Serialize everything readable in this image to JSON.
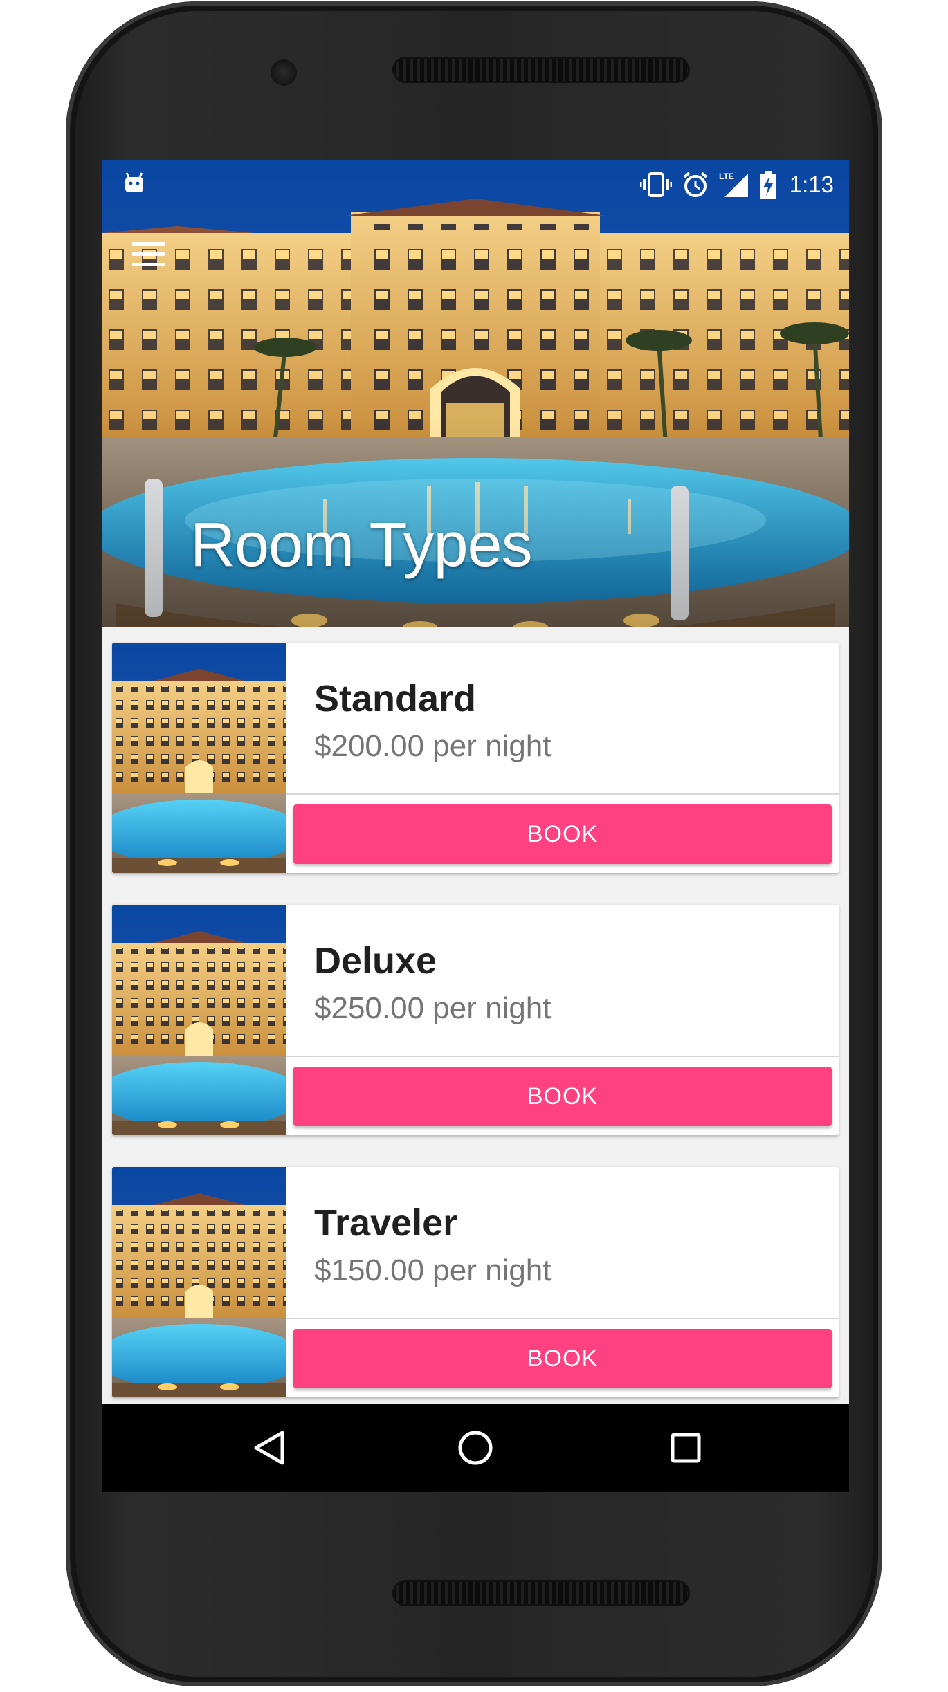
{
  "status_bar": {
    "time": "1:13",
    "network": "LTE",
    "icons": [
      "android-icon",
      "vibrate-icon",
      "alarm-icon",
      "lte-signal-icon",
      "battery-charging-icon"
    ]
  },
  "header": {
    "title": "Room Types",
    "menu_icon": "hamburger-menu-icon",
    "background": "hotel-pool-night-photo"
  },
  "rooms": [
    {
      "name": "Standard",
      "price": "$200.00 per night",
      "action": "BOOK"
    },
    {
      "name": "Deluxe",
      "price": "$250.00 per night",
      "action": "BOOK"
    },
    {
      "name": "Traveler",
      "price": "$150.00 per night",
      "action": "BOOK"
    }
  ],
  "nav_bar": {
    "icons": [
      "back-icon",
      "home-icon",
      "recent-apps-icon"
    ]
  },
  "colors": {
    "accent": "#ff4081",
    "sky": "#0b4ea8",
    "pool": "#27b6e8",
    "building": "#e7b45a"
  }
}
